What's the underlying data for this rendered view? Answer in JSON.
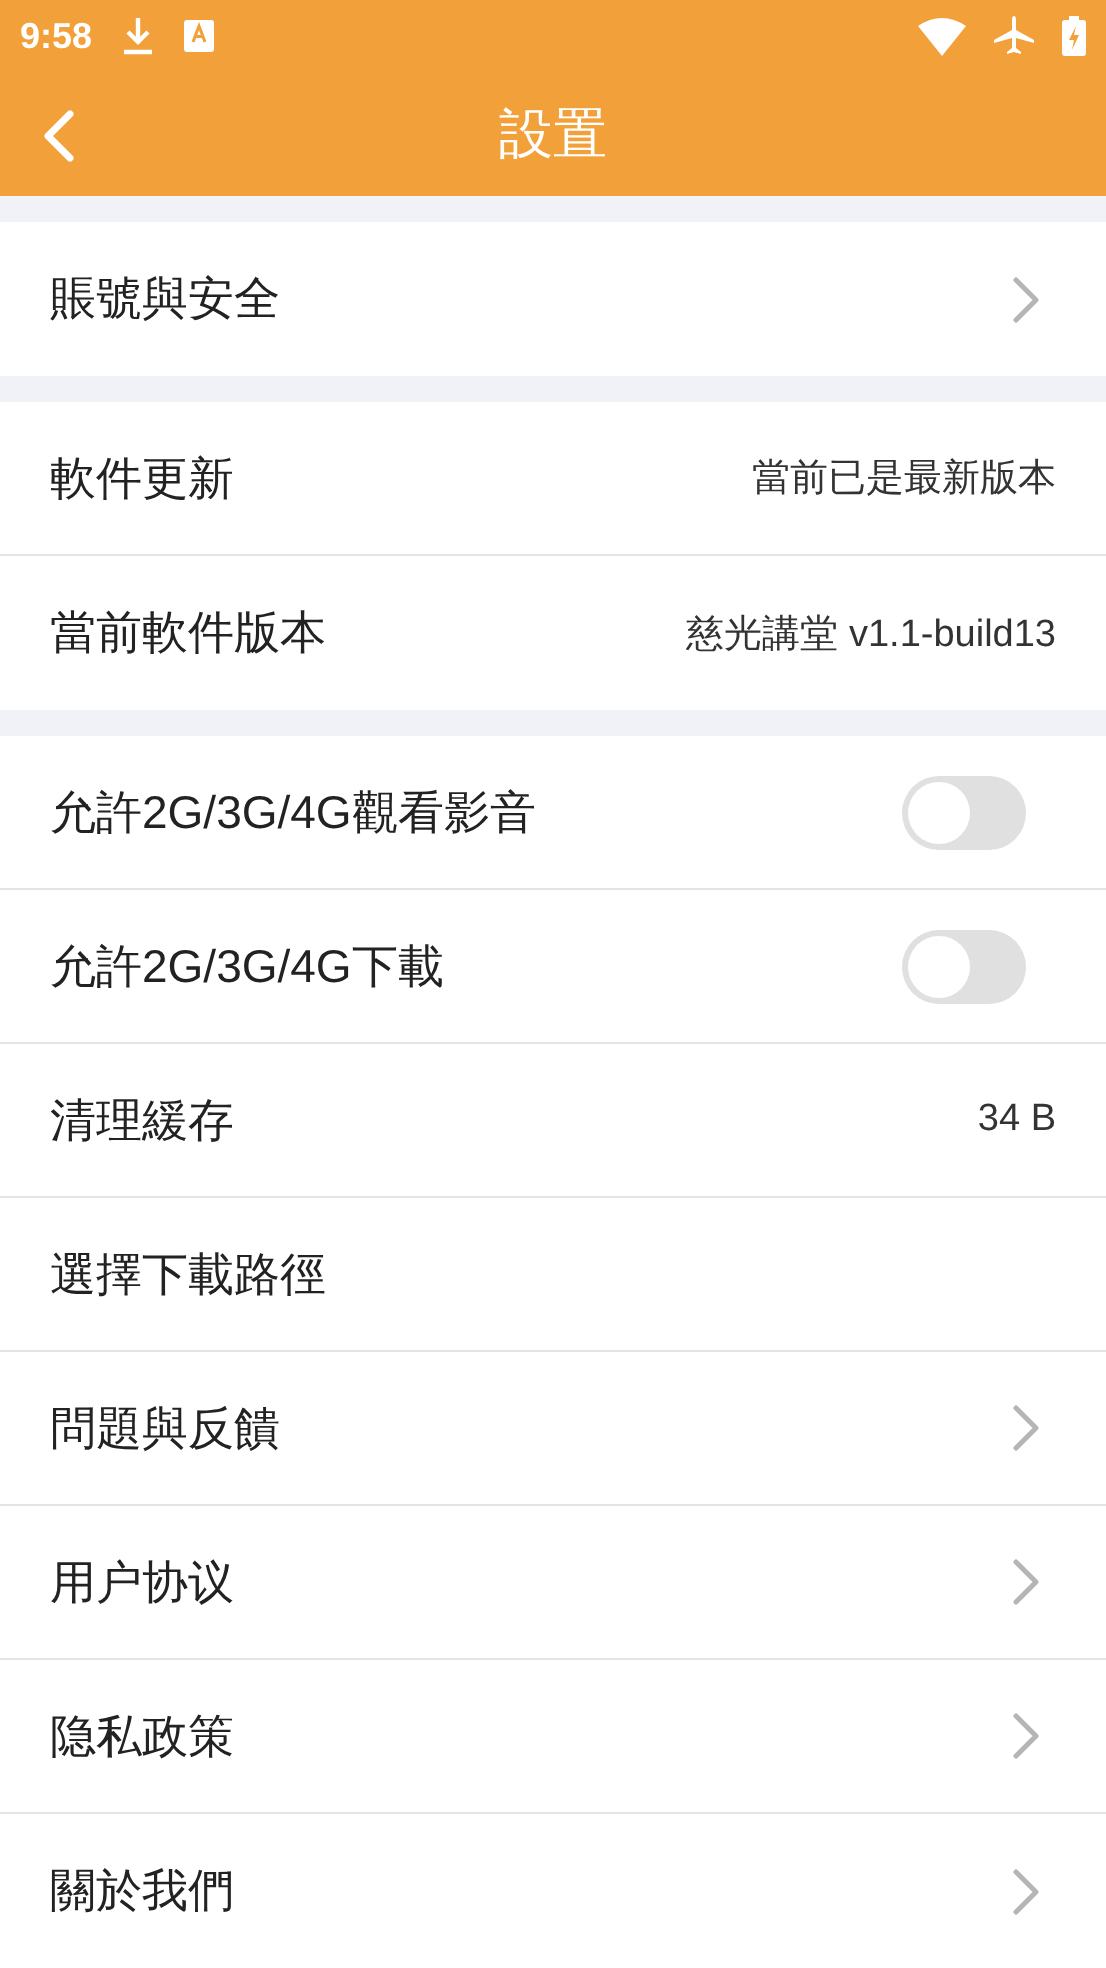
{
  "status_bar": {
    "time": "9:58"
  },
  "app_bar": {
    "title": "設置"
  },
  "sections": [
    {
      "items": [
        {
          "kind": "link",
          "label": "賬號與安全"
        }
      ]
    },
    {
      "items": [
        {
          "kind": "value",
          "label": "軟件更新",
          "value": "當前已是最新版本"
        },
        {
          "kind": "value",
          "label": "當前軟件版本",
          "value": "慈光講堂 v1.1-build13"
        }
      ]
    },
    {
      "items": [
        {
          "kind": "toggle",
          "label": "允許2G/3G/4G觀看影音",
          "on": false
        },
        {
          "kind": "toggle",
          "label": "允許2G/3G/4G下載",
          "on": false
        },
        {
          "kind": "value",
          "label": "清理緩存",
          "value": "34 B"
        },
        {
          "kind": "plain",
          "label": "選擇下載路徑"
        },
        {
          "kind": "link",
          "label": "問題與反饋"
        },
        {
          "kind": "link",
          "label": "用户协议"
        },
        {
          "kind": "link",
          "label": "隐私政策"
        },
        {
          "kind": "link",
          "label": "關於我們"
        }
      ]
    }
  ]
}
